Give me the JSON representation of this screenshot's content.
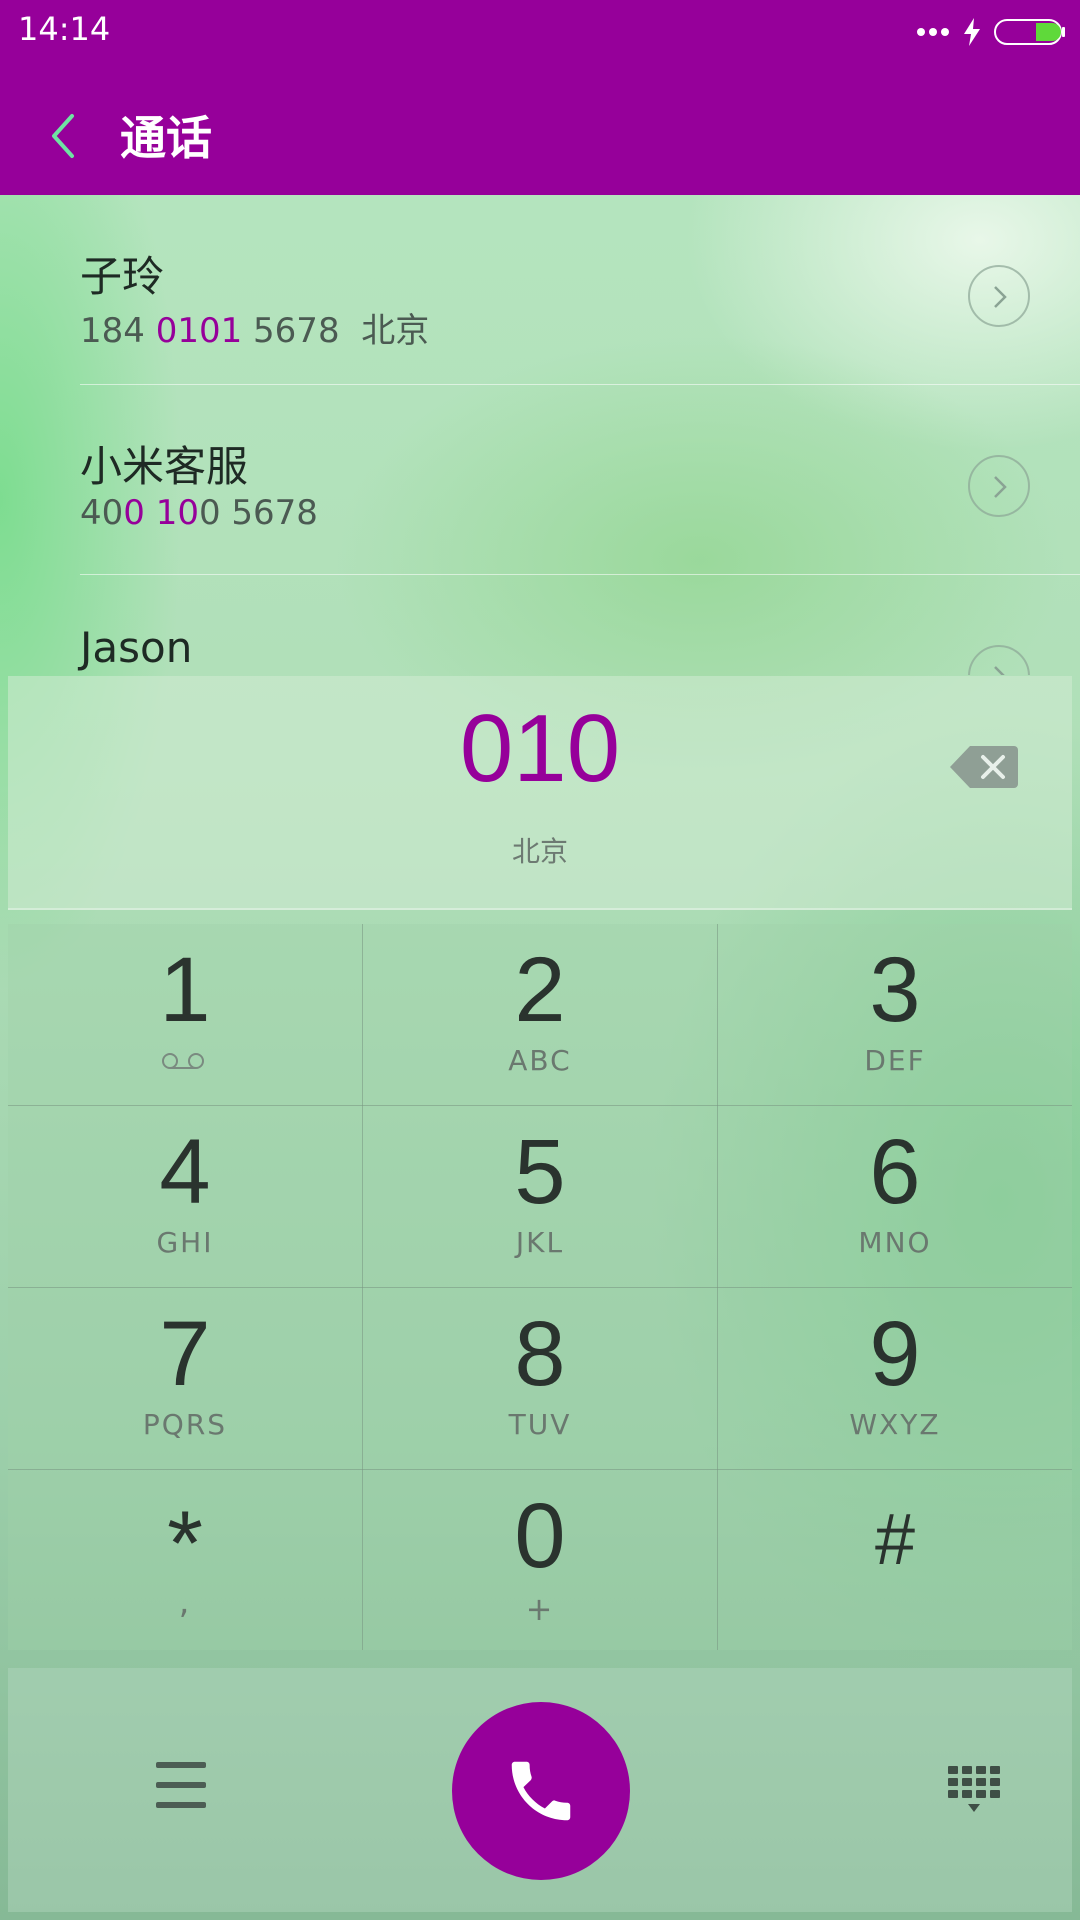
{
  "status_bar": {
    "time": "14:14",
    "icons": [
      "more-dots-icon",
      "charging-bolt-icon",
      "battery-icon"
    ]
  },
  "header": {
    "title": "通话",
    "back_icon": "chevron-left-icon"
  },
  "contacts": [
    {
      "name": "子玲",
      "number_prefix": "184 ",
      "number_match": "0101",
      "number_suffix": " 5678",
      "location": "北京"
    },
    {
      "name": "小米客服",
      "number_prefix": "40",
      "number_match": "0 10",
      "number_suffix": "0 5678",
      "location": ""
    },
    {
      "name": "Jason",
      "number_prefix": "",
      "number_match": "",
      "number_suffix": "",
      "location": ""
    }
  ],
  "dialer": {
    "number": "010",
    "location": "北京",
    "backspace_icon": "backspace-icon"
  },
  "keypad": {
    "keys": [
      {
        "digit": "1",
        "letters": "",
        "icon": "voicemail-icon"
      },
      {
        "digit": "2",
        "letters": "ABC"
      },
      {
        "digit": "3",
        "letters": "DEF"
      },
      {
        "digit": "4",
        "letters": "GHI"
      },
      {
        "digit": "5",
        "letters": "JKL"
      },
      {
        "digit": "6",
        "letters": "MNO"
      },
      {
        "digit": "7",
        "letters": "PQRS"
      },
      {
        "digit": "8",
        "letters": "TUV"
      },
      {
        "digit": "9",
        "letters": "WXYZ"
      },
      {
        "digit": "*",
        "letters": ","
      },
      {
        "digit": "0",
        "letters": "+"
      },
      {
        "digit": "#",
        "letters": ""
      }
    ]
  },
  "bottom_bar": {
    "menu_icon": "menu-icon",
    "call_icon": "phone-icon",
    "dialpad_icon": "dialpad-icon"
  },
  "colors": {
    "accent": "#96009a",
    "text_dark": "#2a332e",
    "text_muted": "#6a786f"
  }
}
